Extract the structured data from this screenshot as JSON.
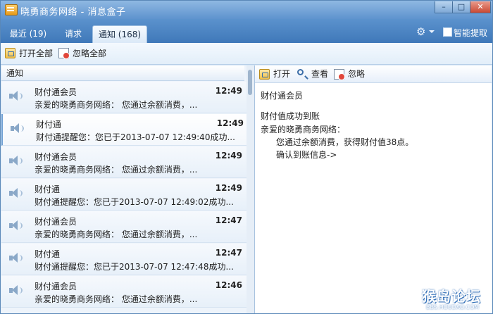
{
  "window": {
    "title": "晓勇商务网络 - 消息盒子",
    "min_label": "–",
    "max_label": "□",
    "close_label": "✕"
  },
  "tabs": [
    {
      "label": "最近 (19)"
    },
    {
      "label": "请求"
    },
    {
      "label": "通知 (168)"
    }
  ],
  "header_right": {
    "gear_icon": "⚙",
    "smart_extract_label": "智能提取"
  },
  "toolbar": {
    "open_all_label": "打开全部",
    "ignore_all_label": "忽略全部"
  },
  "list": {
    "header": "通知",
    "items": [
      {
        "sender": "财付通会员",
        "time": "12:49",
        "preview": "亲爱的晓勇商务网络：   您通过余额消费，..."
      },
      {
        "sender": "财付通",
        "time": "12:49",
        "preview": "财付通提醒您：您已于2013-07-07 12:49:40成功..."
      },
      {
        "sender": "财付通会员",
        "time": "12:49",
        "preview": "亲爱的晓勇商务网络：   您通过余额消费，..."
      },
      {
        "sender": "财付通",
        "time": "12:49",
        "preview": "财付通提醒您：您已于2013-07-07 12:49:02成功..."
      },
      {
        "sender": "财付通会员",
        "time": "12:47",
        "preview": "亲爱的晓勇商务网络：   您通过余额消费，..."
      },
      {
        "sender": "财付通",
        "time": "12:47",
        "preview": "财付通提醒您：您已于2013-07-07 12:47:48成功..."
      },
      {
        "sender": "财付通会员",
        "time": "12:46",
        "preview": "亲爱的晓勇商务网络：   您通过余额消费，..."
      }
    ]
  },
  "detail": {
    "toolbar": {
      "open_label": "打开",
      "view_label": "查看",
      "ignore_label": "忽略"
    },
    "sender": "财付通会员",
    "subject": "财付值成功到账",
    "greeting": "亲爱的晓勇商务网络：",
    "line1": "您通过余额消费，获得财付值38点。",
    "link": "确认到账信息->"
  },
  "watermark": {
    "main": "猴岛论坛",
    "sub": "BBS.HOUDAO.COM"
  }
}
